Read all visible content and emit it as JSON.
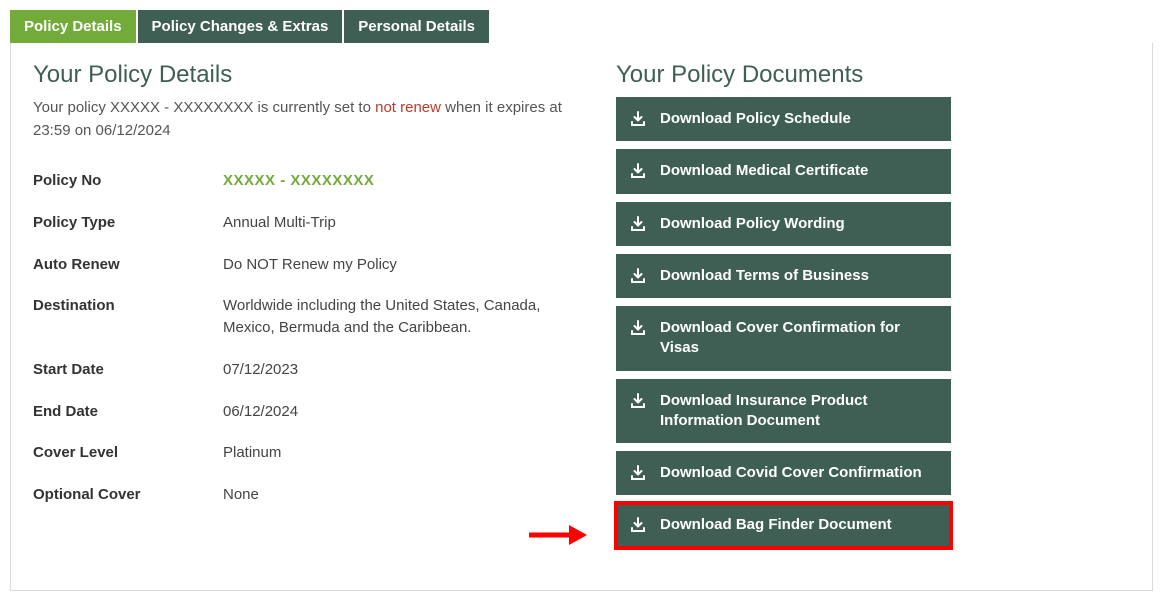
{
  "tabs": [
    {
      "label": "Policy Details",
      "active": true
    },
    {
      "label": "Policy Changes & Extras",
      "active": false
    },
    {
      "label": "Personal Details",
      "active": false
    }
  ],
  "left": {
    "heading": "Your Policy Details",
    "intro_prefix": "Your policy XXXXX - XXXXXXXX  is currently set to",
    "intro_not_renew": "not renew",
    "intro_suffix": "when it expires at 23:59 on 06/12/2024",
    "rows": [
      {
        "label": "Policy No",
        "value": "XXXXX - XXXXXXXX",
        "green": true
      },
      {
        "label": "Policy Type",
        "value": "Annual Multi-Trip"
      },
      {
        "label": "Auto Renew",
        "value": "Do NOT Renew my Policy"
      },
      {
        "label": "Destination",
        "value": "Worldwide including the United States, Canada, Mexico, Bermuda and the Caribbean."
      },
      {
        "label": "Start Date",
        "value": "07/12/2023"
      },
      {
        "label": "End Date",
        "value": "06/12/2024"
      },
      {
        "label": "Cover Level",
        "value": "Platinum"
      },
      {
        "label": "Optional Cover",
        "value": "None"
      }
    ]
  },
  "right": {
    "heading": "Your Policy Documents",
    "buttons": [
      {
        "label": "Download Policy Schedule",
        "highlight": false
      },
      {
        "label": "Download Medical Certificate",
        "highlight": false
      },
      {
        "label": "Download Policy Wording",
        "highlight": false
      },
      {
        "label": "Download Terms of Business",
        "highlight": false
      },
      {
        "label": "Download Cover Confirmation for Visas",
        "highlight": false
      },
      {
        "label": "Download Insurance Product Information Document",
        "highlight": false
      },
      {
        "label": "Download Covid Cover Confirmation",
        "highlight": false
      },
      {
        "label": "Download Bag Finder Document",
        "highlight": true
      }
    ]
  }
}
